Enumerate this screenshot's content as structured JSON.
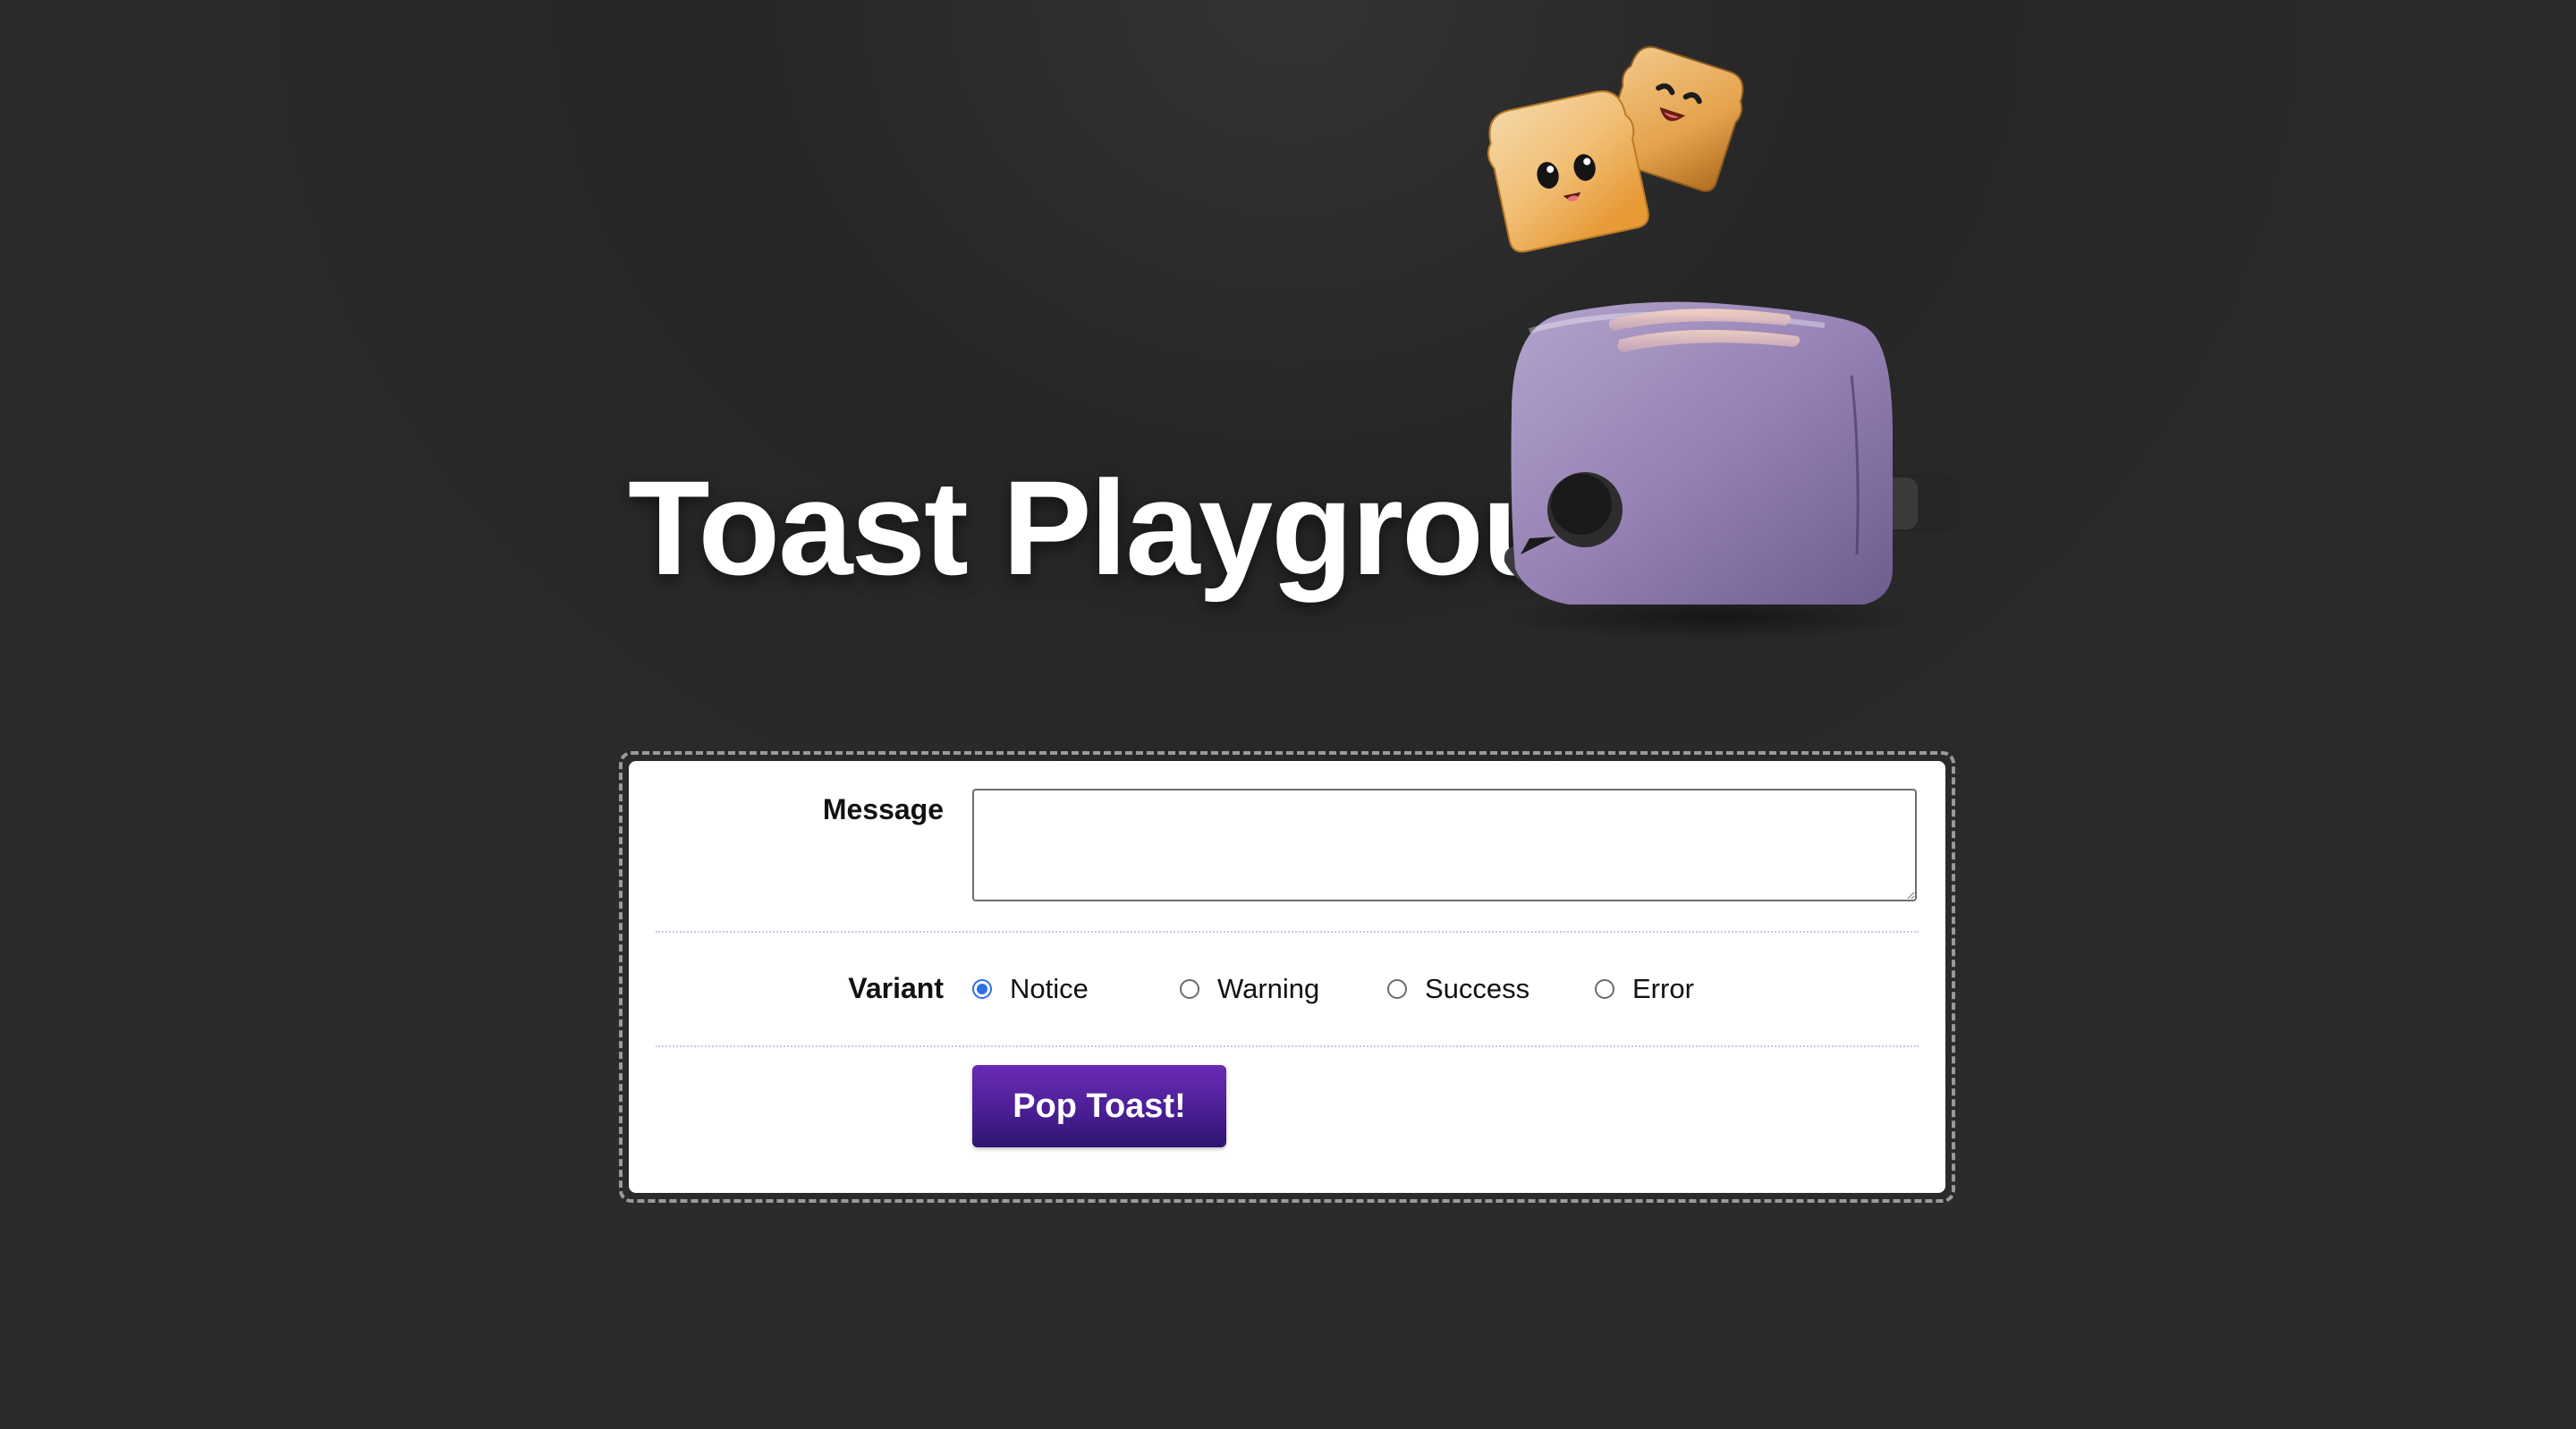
{
  "page": {
    "title": "Toast Playground",
    "illustration": "toaster-with-toast-icon"
  },
  "form": {
    "message": {
      "label": "Message",
      "value": "",
      "placeholder": ""
    },
    "variant": {
      "label": "Variant",
      "selected": "Notice",
      "options": [
        "Notice",
        "Warning",
        "Success",
        "Error"
      ]
    },
    "submit_label": "Pop Toast!"
  },
  "colors": {
    "background": "#2a2a2a",
    "button": "#4b1f95",
    "radio_accent": "#2f6fe4",
    "toaster": "#9a85b5"
  }
}
